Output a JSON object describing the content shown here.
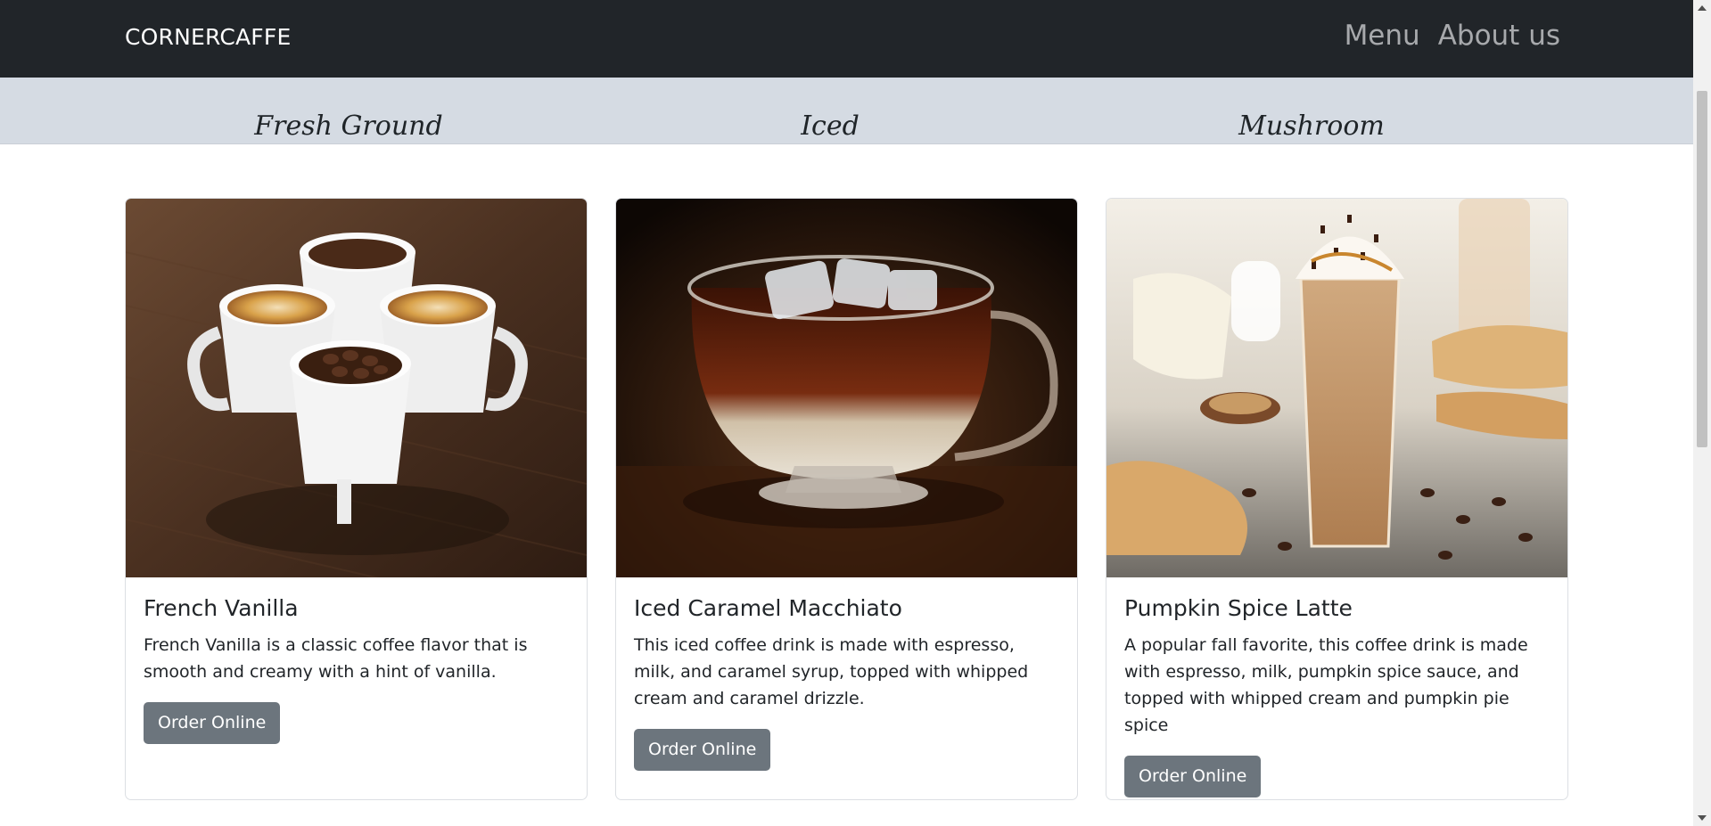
{
  "navbar": {
    "brand": "CORNERCAFFE",
    "links": [
      "Menu",
      "About us"
    ]
  },
  "categories": [
    "Fresh Ground",
    "Iced",
    "Mushroom"
  ],
  "cards": [
    {
      "image": "four-coffee-cups-with-beans-and-grounds",
      "title": "French Vanilla",
      "text": "French Vanilla is a classic coffee flavor that is smooth and creamy with a hint of vanilla.",
      "button": "Order Online"
    },
    {
      "image": "iced-caramel-coffee-glass-cup",
      "title": "Iced Caramel Macchiato",
      "text": "This iced coffee drink is made with espresso, milk, and caramel syrup, topped with whipped cream and caramel drizzle.",
      "button": "Order Online"
    },
    {
      "image": "pumpkin-spice-latte-glass-with-whipped-cream",
      "title": "Pumpkin Spice Latte",
      "text": "A popular fall favorite, this coffee drink is made with espresso, milk, pumpkin spice sauce, and topped with whipped cream and pumpkin pie spice",
      "button": "Order Online"
    }
  ],
  "colors": {
    "navbar_bg": "#212529",
    "category_band_bg": "#d5dbe3",
    "button_bg": "#6c757d"
  }
}
